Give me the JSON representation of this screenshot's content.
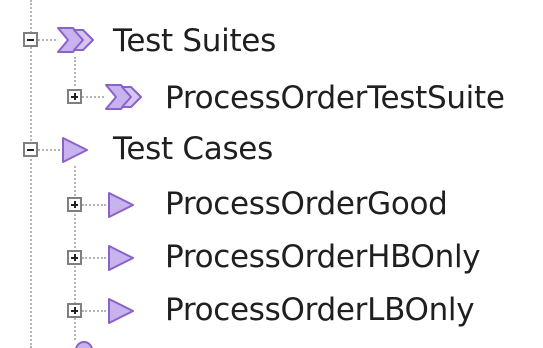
{
  "tree": {
    "test_suites": {
      "label": "Test Suites",
      "expanded": true,
      "icon": "double-chevron-icon",
      "children": [
        {
          "label": "ProcessOrderTestSuite",
          "expanded": false,
          "icon": "double-chevron-icon"
        }
      ]
    },
    "test_cases": {
      "label": "Test Cases",
      "expanded": true,
      "icon": "triangle-play-icon",
      "children": [
        {
          "label": "ProcessOrderGood",
          "expanded": false,
          "icon": "triangle-play-icon"
        },
        {
          "label": "ProcessOrderHBOnly",
          "expanded": false,
          "icon": "triangle-play-icon"
        },
        {
          "label": "ProcessOrderLBOnly",
          "expanded": false,
          "icon": "triangle-play-icon"
        }
      ]
    }
  },
  "colors": {
    "icon_fill": "#c9b3ee",
    "icon_stroke": "#8a63c9",
    "guide_line": "#b4b4b4",
    "toggle_border": "#7f7f7f",
    "text": "#1f1f1f"
  }
}
